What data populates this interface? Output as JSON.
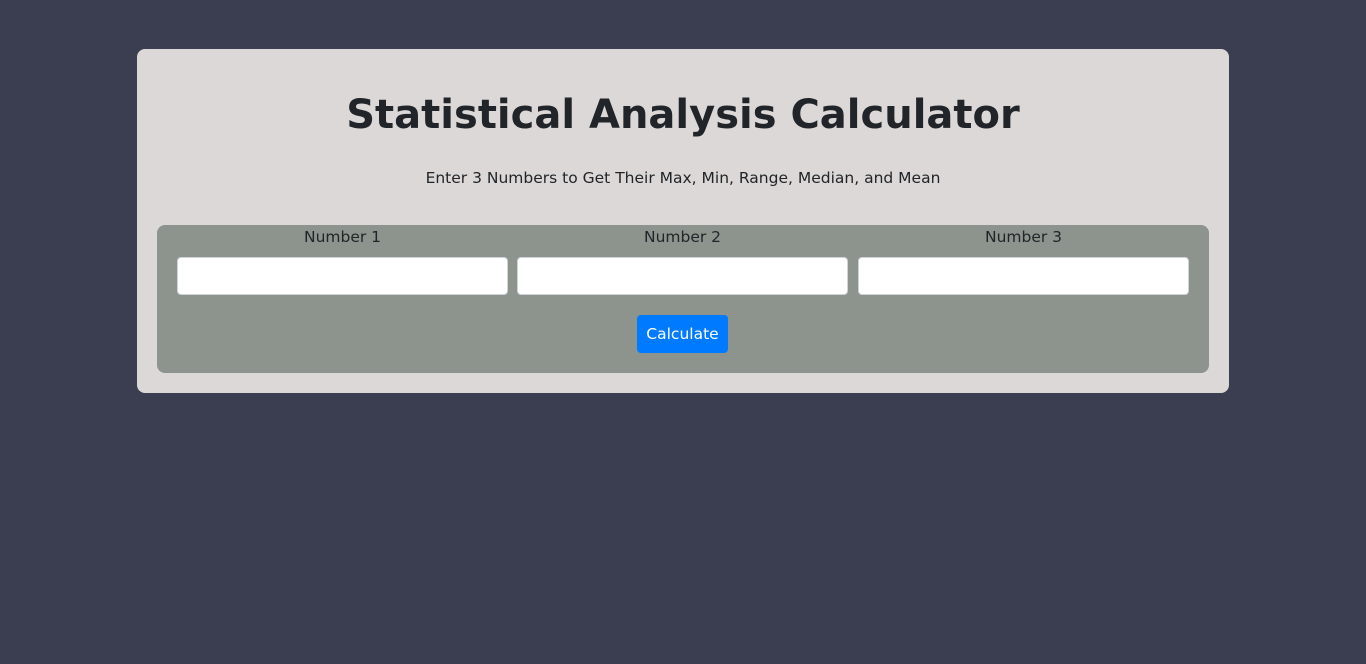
{
  "app": {
    "title": "Statistical Analysis Calculator",
    "subtitle": "Enter 3 Numbers to Get Their Max, Min, Range, Median, and Mean"
  },
  "form": {
    "fields": [
      {
        "label": "Number 1",
        "value": "",
        "placeholder": ""
      },
      {
        "label": "Number 2",
        "value": "",
        "placeholder": ""
      },
      {
        "label": "Number 3",
        "value": "",
        "placeholder": ""
      }
    ],
    "submit_label": "Calculate"
  },
  "colors": {
    "page_background": "#3b3d50",
    "card_background": "#dcd8d7",
    "form_background": "#8d938d",
    "button_primary": "#007bff",
    "text_dark": "#212529"
  }
}
